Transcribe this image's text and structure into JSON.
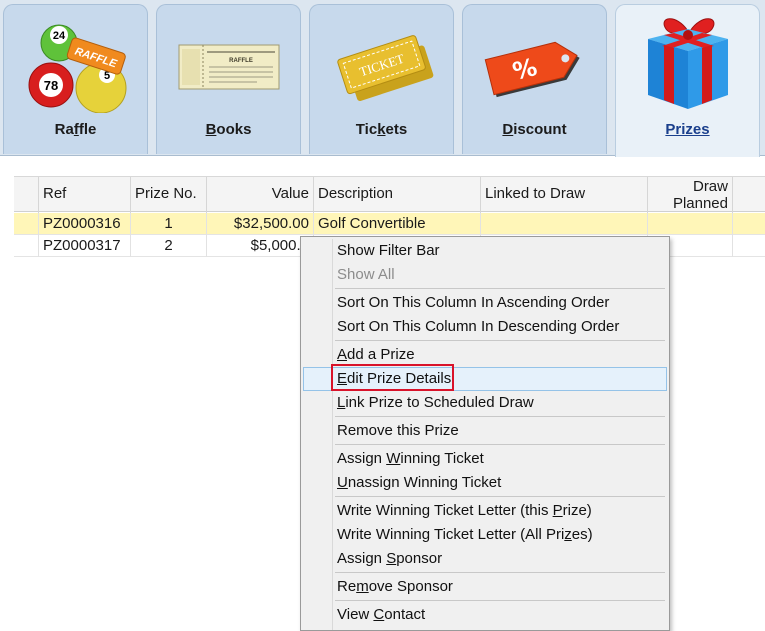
{
  "tabs": [
    {
      "id": "raffle",
      "pre": "Ra",
      "key": "f",
      "post": "fle",
      "active": false
    },
    {
      "id": "books",
      "pre": "",
      "key": "B",
      "post": "ooks",
      "active": false
    },
    {
      "id": "tickets",
      "pre": "Tic",
      "key": "k",
      "post": "ets",
      "active": false
    },
    {
      "id": "discount",
      "pre": "",
      "key": "D",
      "post": "iscount",
      "active": false
    },
    {
      "id": "prizes",
      "pre": "Prizes",
      "key": "",
      "post": "",
      "active": true
    }
  ],
  "tab_art": {
    "balls": [
      "24",
      "78",
      "5"
    ],
    "raffle_tag": "RAFFLE",
    "ticket_text": "TICKET",
    "book_title": "RAFFLE",
    "discount_symbol": "%"
  },
  "grid": {
    "headers": {
      "ref": "Ref",
      "prize_no": "Prize No.",
      "value": "Value",
      "description": "Description",
      "linked": "Linked to Draw",
      "draw_planned_1": "Draw",
      "draw_planned_2": "Planned"
    },
    "rows": [
      {
        "ref": "PZ0000316",
        "prize_no": "1",
        "value": "$32,500.00",
        "description": "Golf Convertible",
        "linked": "",
        "planned": ""
      },
      {
        "ref": "PZ0000317",
        "prize_no": "2",
        "value": "$5,000.0",
        "description": "",
        "linked": "",
        "planned": ""
      }
    ]
  },
  "context_menu": {
    "items": [
      {
        "pre": "Show Filter Bar",
        "key": "",
        "post": ""
      },
      {
        "pre": "Show All",
        "key": "",
        "post": ""
      },
      {
        "pre": "Sort On This Column In Ascending Order",
        "key": "",
        "post": ""
      },
      {
        "pre": "Sort On This Column In Descending Order",
        "key": "",
        "post": ""
      },
      {
        "pre": "",
        "key": "A",
        "post": "dd a Prize"
      },
      {
        "pre": "",
        "key": "E",
        "post": "dit Prize Details"
      },
      {
        "pre": "",
        "key": "L",
        "post": "ink Prize to Scheduled Draw"
      },
      {
        "pre": "Remove this Prize",
        "key": "",
        "post": ""
      },
      {
        "pre": "Assign ",
        "key": "W",
        "post": "inning Ticket"
      },
      {
        "pre": "",
        "key": "U",
        "post": "nassign Winning Ticket"
      },
      {
        "pre": "Write Winning Ticket Letter (this ",
        "key": "P",
        "post": "rize)"
      },
      {
        "pre": "Write Winning Ticket Letter (All Pri",
        "key": "z",
        "post": "es)"
      },
      {
        "pre": "Assign ",
        "key": "S",
        "post": "ponsor"
      },
      {
        "pre": "Re",
        "key": "m",
        "post": "ove Sponsor"
      },
      {
        "pre": "View ",
        "key": "C",
        "post": "ontact"
      }
    ]
  },
  "colors": {
    "selected_row": "#fff6b8",
    "highlight_border": "#d9132a",
    "hover_item": "#e5f1fb"
  }
}
